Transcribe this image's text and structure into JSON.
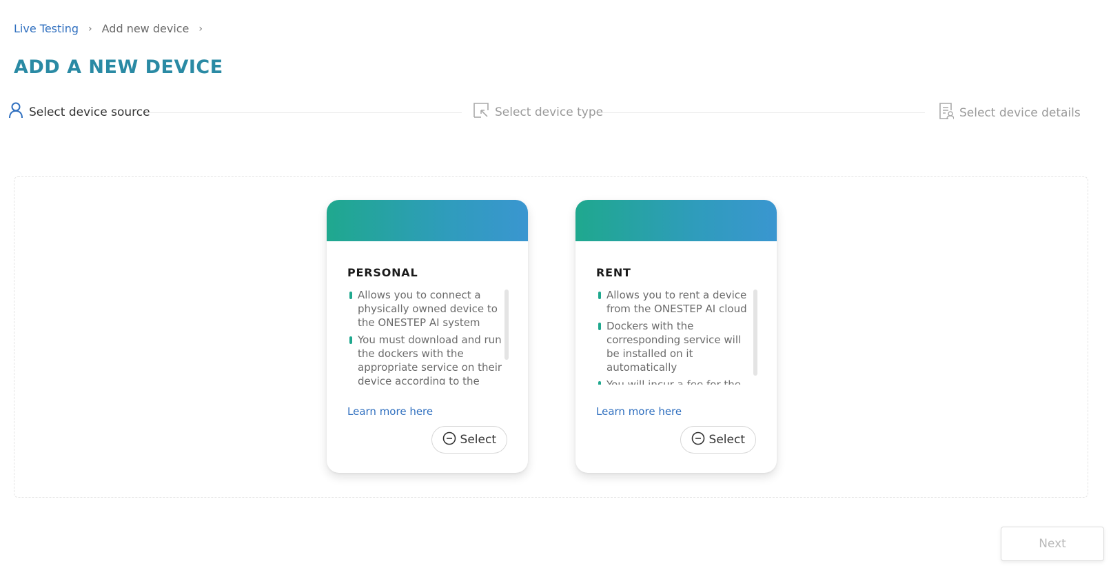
{
  "breadcrumb": {
    "items": [
      {
        "label": "Live Testing",
        "link": true
      },
      {
        "label": "Add new device",
        "link": false
      }
    ],
    "separator": "›"
  },
  "page_title": "ADD A NEW DEVICE",
  "steps": [
    {
      "label": "Select device source",
      "icon": "user-icon",
      "state": "active"
    },
    {
      "label": "Select device type",
      "icon": "cursor-select-icon",
      "state": "inactive"
    },
    {
      "label": "Select device details",
      "icon": "document-user-icon",
      "state": "inactive"
    }
  ],
  "cards": [
    {
      "title": "PERSONAL",
      "bullets": [
        "Allows you to connect a physically owned device to the ONESTEP AI system",
        "You must download and run the dockers with the appropriate service on their device according to the"
      ],
      "learn_more": "Learn more here",
      "select_label": "Select"
    },
    {
      "title": "RENT",
      "bullets": [
        "Allows you to rent a device from the ONESTEP AI cloud",
        "Dockers with the corresponding service will be installed on it automatically",
        "You will incur a fee for the"
      ],
      "learn_more": "Learn more here",
      "select_label": "Select"
    }
  ],
  "next_button": {
    "label": "Next",
    "disabled": true
  },
  "colors": {
    "title": "#2a8aa4",
    "link": "#2f6fbf",
    "accent_gradient_start": "#1fa88e",
    "accent_gradient_end": "#3a96d0",
    "bullet": "#1fa88e"
  }
}
